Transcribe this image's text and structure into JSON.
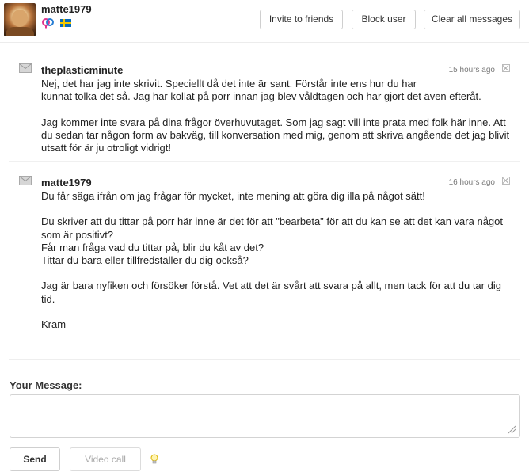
{
  "header": {
    "username": "matte1979",
    "gender_icon": "couple-gender-icon",
    "flag_icon": "sweden-flag-icon",
    "buttons": {
      "invite": "Invite to friends",
      "block": "Block user",
      "clear": "Clear all messages"
    }
  },
  "messages": [
    {
      "sender": "theplasticminute",
      "time": "15 hours ago",
      "icon": "envelope-icon",
      "body": "Nej, det har jag inte skrivit. Speciellt då det inte är sant. Förstår inte ens hur du har\nkunnat tolka det så. Jag har kollat på porr innan jag blev våldtagen och har gjort det även efteråt.\n\nJag kommer inte svara på dina frågor överhuvutaget. Som jag sagt vill inte prata med folk här inne. Att du sedan tar någon form av bakväg, till konversation med mig, genom att skriva angående det jag blivit utsatt för är ju otroligt vidrigt!"
    },
    {
      "sender": "matte1979",
      "time": "16 hours ago",
      "icon": "envelope-icon",
      "body": "Du får säga ifrån om jag frågar för mycket, inte mening att göra dig illa på något sätt!\n\nDu skriver att du tittar på porr här inne är det för att \"bearbeta\" för att du kan se att det kan vara något som är positivt?\nFår man fråga vad du tittar på, blir du kåt av det?\nTittar du bara eller tillfredställer du dig också?\n\nJag är bara nyfiken och försöker förstå. Vet att det är svårt att svara på allt, men tack för att du tar dig tid.\n\nKram"
    }
  ],
  "composer": {
    "label": "Your Message:",
    "value": "",
    "send_label": "Send",
    "video_label": "Video call",
    "hint_icon": "lightbulb-icon"
  }
}
